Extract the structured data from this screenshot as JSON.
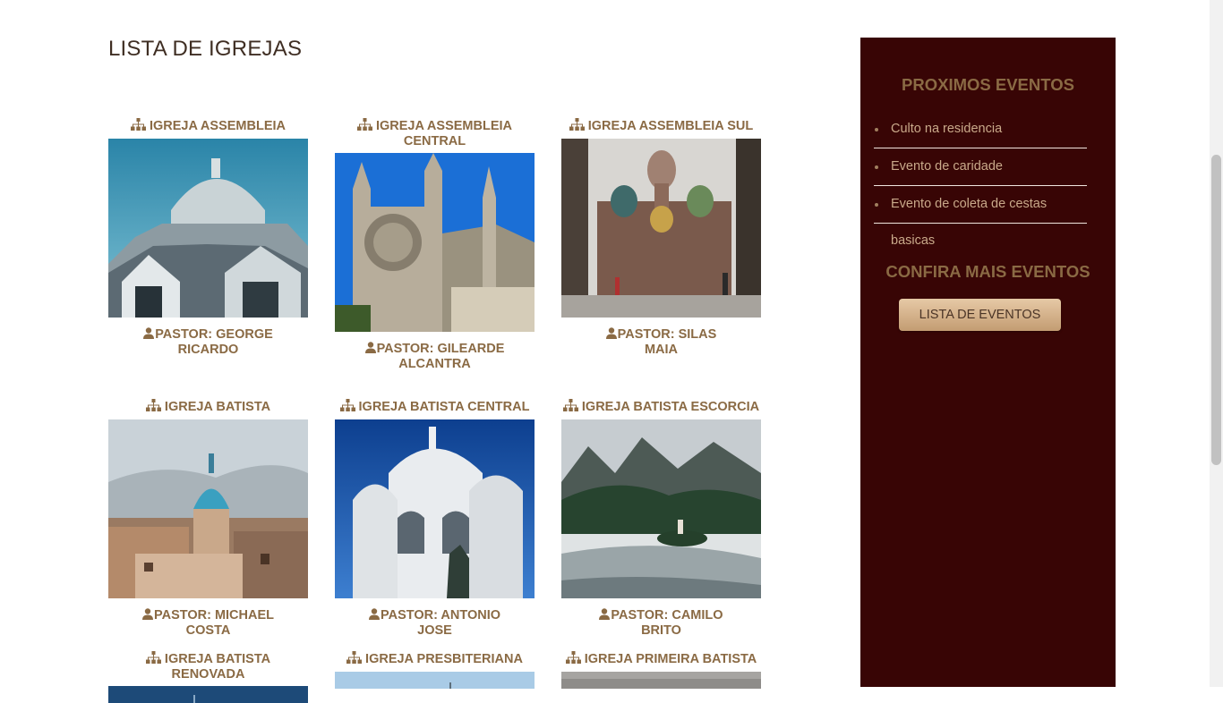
{
  "page": {
    "title": "LISTA DE IGREJAS"
  },
  "churches": [
    {
      "name": "IGREJA ASSEMBLEIA",
      "pastor": "PASTOR: GEORGE RICARDO",
      "photo": "baroque-church-dome-photo"
    },
    {
      "name": "IGREJA ASSEMBLEIA CENTRAL",
      "pastor": "PASTOR: GILEARDE ALCANTRA",
      "photo": "gothic-cathedral-rose-window-photo"
    },
    {
      "name": "IGREJA ASSEMBLEIA SUL",
      "pastor": "PASTOR: SILAS MAIA",
      "photo": "onion-dome-church-photo"
    },
    {
      "name": "IGREJA BATISTA",
      "pastor": "PASTOR: MICHAEL COSTA",
      "photo": "hillside-town-dome-photo"
    },
    {
      "name": "IGREJA BATISTA CENTRAL",
      "pastor": "PASTOR: ANTONIO JOSE",
      "photo": "white-basilica-photo"
    },
    {
      "name": "IGREJA BATISTA ESCORCIA",
      "pastor": "PASTOR: CAMILO BRITO",
      "photo": "lake-island-church-photo"
    },
    {
      "name": "IGREJA BATISTA RENOVADA",
      "pastor": "",
      "photo": "blue-sky-photo"
    },
    {
      "name": "IGREJA PRESBITERIANA",
      "pastor": "",
      "photo": "light-sky-photo"
    },
    {
      "name": "IGREJA PRIMEIRA BATISTA",
      "pastor": "",
      "photo": "cloudy-sky-photo"
    }
  ],
  "sidebar": {
    "events_heading": "PROXIMOS EVENTOS",
    "events": [
      "Culto na residencia",
      "Evento de caridade",
      "Evento de coleta de cestas basicas"
    ],
    "more_heading": "CONFIRA MAIS EVENTOS",
    "button_label": "LISTA DE EVENTOS"
  },
  "icons": {
    "church": "church-network-icon",
    "pastor": "user-icon"
  },
  "colors": {
    "accent_text": "#8a6a44",
    "sidebar_bg": "#380505",
    "button": "#d8b48e"
  }
}
